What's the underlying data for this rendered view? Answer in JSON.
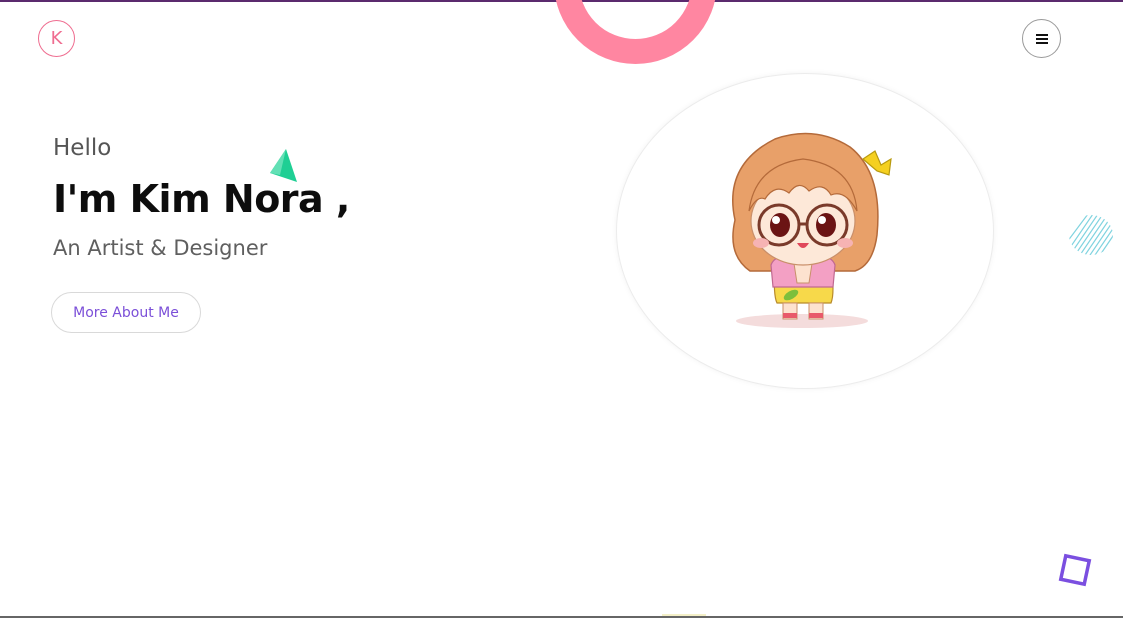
{
  "header": {
    "logo_letter": "K",
    "menu_icon": "hamburger-icon"
  },
  "hero": {
    "greeting": "Hello",
    "title": "I'm Kim Nora ,",
    "role": "An Artist & Designer",
    "cta_label": "More About Me"
  },
  "decorations": {
    "ring": "pink-ring-shape",
    "triangle": "green-triangle-shape",
    "hatch": "striped-circle-shape",
    "square": "purple-square-shape",
    "avatar": "chibi-girl-illustration"
  },
  "colors": {
    "accent_pink": "#ef6d90",
    "ring_pink": "#ff86a1",
    "accent_purple": "#7b4fd8",
    "triangle_green": "#1fcf94",
    "hatch_cyan": "#7fd3df"
  }
}
